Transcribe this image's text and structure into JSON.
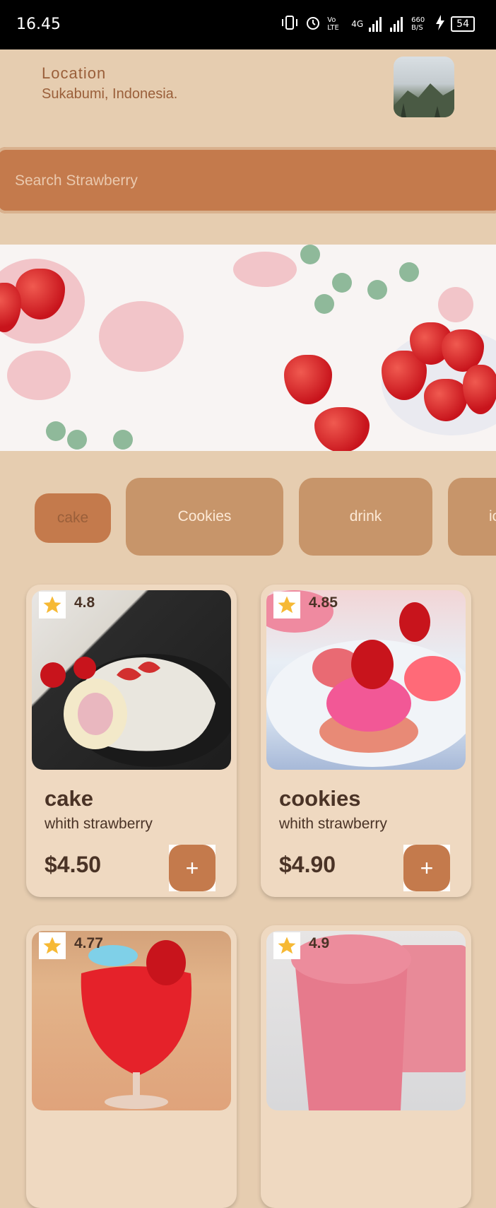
{
  "status_bar": {
    "time": "16.45",
    "volte": "Vo LTE",
    "network": "4G",
    "speed": "660 B/S",
    "battery": "54"
  },
  "location": {
    "label": "Location",
    "value": "Sukabumi, Indonesia."
  },
  "search": {
    "placeholder": "Search Strawberry"
  },
  "categories": [
    {
      "label": "cake",
      "active": true
    },
    {
      "label": "Cookies",
      "active": false
    },
    {
      "label": "drink",
      "active": false
    },
    {
      "label": "ic",
      "active": false
    }
  ],
  "products": [
    {
      "name": "cake",
      "subtitle": "whith strawberry",
      "price": "$4.50",
      "rating": "4.8",
      "add_label": "+"
    },
    {
      "name": "cookies",
      "subtitle": "whith strawberry",
      "price": "$4.90",
      "rating": "4.85",
      "add_label": "+"
    },
    {
      "name": "",
      "subtitle": "",
      "price": "",
      "rating": "4.77",
      "add_label": ""
    },
    {
      "name": "",
      "subtitle": "",
      "price": "",
      "rating": "4.9",
      "add_label": ""
    }
  ],
  "colors": {
    "background": "#e6cdb0",
    "accent": "#c47a4c",
    "chip": "#c7956a",
    "card": "#efd9c1",
    "text": "#4a3326",
    "location_text": "#9a5f3a",
    "star": "#f6b935"
  }
}
